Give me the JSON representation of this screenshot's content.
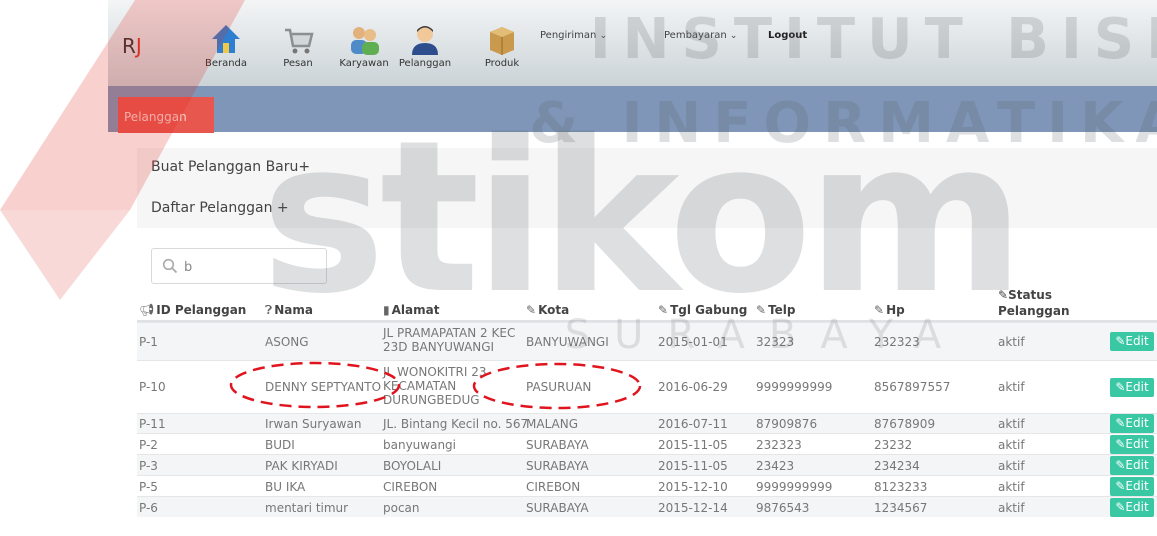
{
  "navbar": {
    "brand_r": "R",
    "brand_j": "J",
    "items": [
      {
        "label": "Beranda",
        "icon": "home-icon"
      },
      {
        "label": "Pesan",
        "icon": "cart-icon"
      },
      {
        "label": "Karyawan",
        "icon": "employees-icon"
      },
      {
        "label": "Pelanggan",
        "icon": "customer-icon"
      },
      {
        "label": "Produk",
        "icon": "box-icon"
      }
    ],
    "dropdowns": [
      {
        "label": "Pengiriman",
        "chevron": "⌄"
      },
      {
        "label": "Pembayaran",
        "chevron": "⌄"
      }
    ],
    "logout": "Logout"
  },
  "page_tab": "Pelanggan",
  "panel": {
    "create_link": "Buat Pelanggan Baru+",
    "list_link": "Daftar Pelanggan +"
  },
  "search": {
    "value": "b",
    "icon": "search-icon"
  },
  "table": {
    "headers": {
      "id": "ID Pelanggan",
      "nama": "Nama",
      "alamat": "Alamat",
      "kota": "Kota",
      "tgl": "Tgl Gabung",
      "telp": "Telp",
      "hp": "Hp",
      "status_1": "Status",
      "status_2": "Pelanggan"
    },
    "edit_label": "Edit",
    "rows": [
      {
        "id": "P-1",
        "nama": "ASONG",
        "alamat": "JL PRAMAPATAN 2 KEC 23D BANYUWANGI",
        "kota": "BANYUWANGI",
        "tgl": "2015-01-01",
        "telp": "32323",
        "hp": "232323",
        "status": "aktif"
      },
      {
        "id": "P-10",
        "nama": "DENNY SEPTYANTO",
        "alamat": "JL WONOKITRI 23 KECAMATAN DURUNGBEDUG",
        "kota": "PASURUAN",
        "tgl": "2016-06-29",
        "telp": "9999999999",
        "hp": "8567897557",
        "status": "aktif"
      },
      {
        "id": "P-11",
        "nama": "Irwan Suryawan",
        "alamat": "JL. Bintang Kecil no. 567",
        "kota": "MALANG",
        "tgl": "2016-07-11",
        "telp": "87909876",
        "hp": "87678909",
        "status": "aktif"
      },
      {
        "id": "P-2",
        "nama": "BUDI",
        "alamat": "banyuwangi",
        "kota": "SURABAYA",
        "tgl": "2015-11-05",
        "telp": "232323",
        "hp": "23232",
        "status": "aktif"
      },
      {
        "id": "P-3",
        "nama": "PAK KIRYADI",
        "alamat": "BOYOLALI",
        "kota": "SURABAYA",
        "tgl": "2015-11-05",
        "telp": "23423",
        "hp": "234234",
        "status": "aktif"
      },
      {
        "id": "P-5",
        "nama": "BU IKA",
        "alamat": "CIREBON",
        "kota": "CIREBON",
        "tgl": "2015-12-10",
        "telp": "9999999999",
        "hp": "8123233",
        "status": "aktif"
      },
      {
        "id": "P-6",
        "nama": "mentari timur",
        "alamat": "pocan",
        "kota": "SURABAYA",
        "tgl": "2015-12-14",
        "telp": "9876543",
        "hp": "1234567",
        "status": "aktif"
      }
    ]
  },
  "watermark": {
    "line1": "INSTITUT BISNIS",
    "line2": "& INFORMATIKA",
    "logo": "stikom",
    "city": "SURABAYA"
  },
  "colors": {
    "accent_red": "#d8322b",
    "edit_green": "#39c8a3",
    "annotation_red": "#e0141e"
  }
}
